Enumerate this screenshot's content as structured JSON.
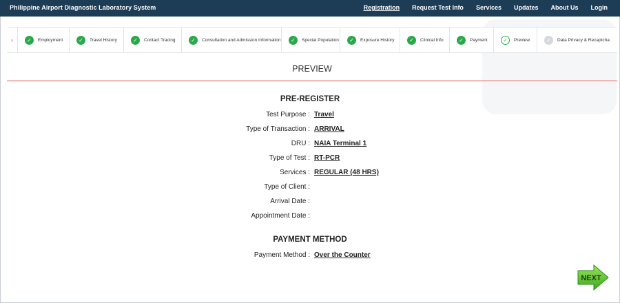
{
  "header": {
    "brand": "Philippine Airport Diagnostic Laboratory System",
    "nav": [
      "Registration",
      "Request Test Info",
      "Services",
      "Updates",
      "About Us",
      "Login"
    ]
  },
  "steps": [
    {
      "label": "Employment",
      "state": "done"
    },
    {
      "label": "Travel History",
      "state": "done"
    },
    {
      "label": "Contact Tracing",
      "state": "done"
    },
    {
      "label": "Consultation and Admission Information",
      "state": "done"
    },
    {
      "label": "Special Population",
      "state": "done"
    },
    {
      "label": "Exposure History",
      "state": "done"
    },
    {
      "label": "Clinical Info",
      "state": "done"
    },
    {
      "label": "Payment",
      "state": "done"
    },
    {
      "label": "Preview",
      "state": "current"
    },
    {
      "label": "Data Privacy & Recaptcha",
      "state": "pending"
    }
  ],
  "preview": {
    "title": "PREVIEW",
    "preregister": {
      "title": "PRE-REGISTER",
      "fields": [
        {
          "label": "Test Purpose :",
          "value": "Travel"
        },
        {
          "label": "Type of Transaction :",
          "value": "ARRIVAL"
        },
        {
          "label": "DRU :",
          "value": "NAIA Terminal 1"
        },
        {
          "label": "Type of Test :",
          "value": "RT-PCR"
        },
        {
          "label": "Services :",
          "value": "REGULAR (48 HRS)"
        },
        {
          "label": "Type of Client :",
          "value": ""
        },
        {
          "label": "Arrival Date :",
          "value": ""
        },
        {
          "label": "Appointment Date :",
          "value": ""
        }
      ]
    },
    "payment": {
      "title": "PAYMENT METHOD",
      "fields": [
        {
          "label": "Payment Method :",
          "value": "Over the Counter"
        }
      ]
    }
  },
  "next_label": "NEXT",
  "colors": {
    "nav_bg": "#1d3c55",
    "check": "#2aa84a",
    "rule": "#d9534f",
    "next_green": "#5cc531"
  }
}
